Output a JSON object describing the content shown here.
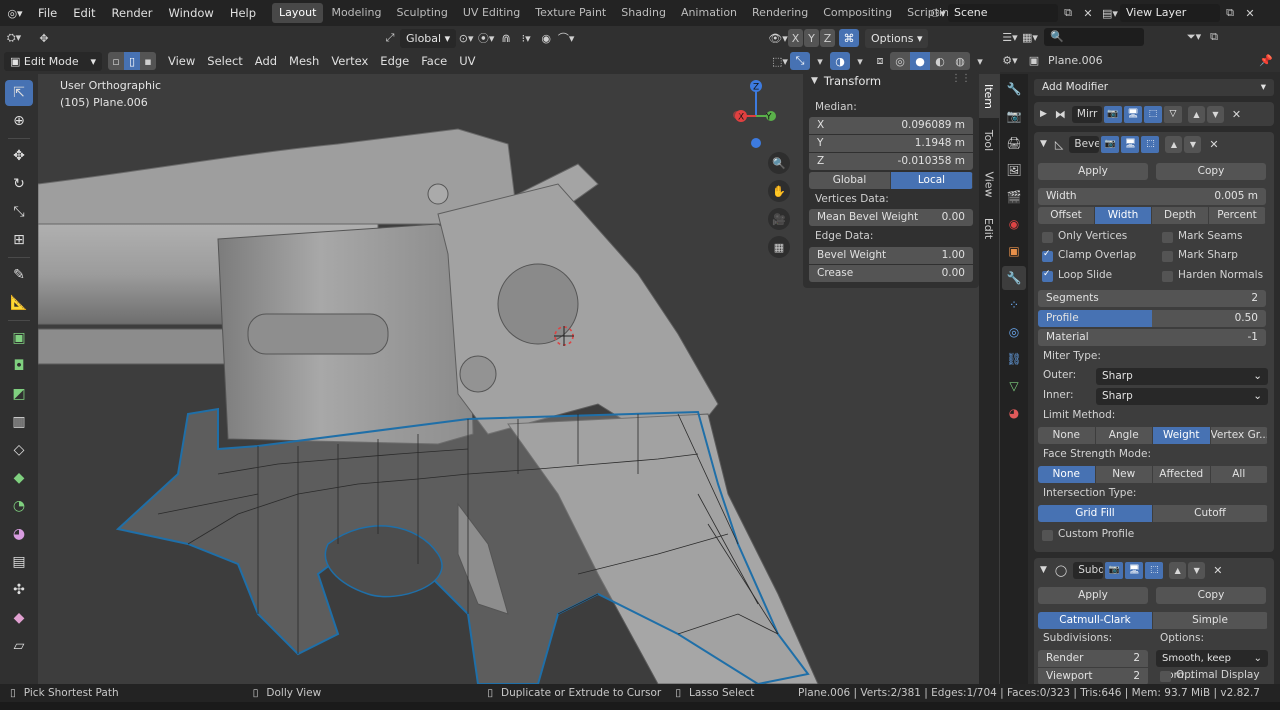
{
  "topmenu": {
    "file": "File",
    "edit": "Edit",
    "render": "Render",
    "window": "Window",
    "help": "Help"
  },
  "workspaces": [
    "Layout",
    "Modeling",
    "Sculpting",
    "UV Editing",
    "Texture Paint",
    "Shading",
    "Animation",
    "Rendering",
    "Compositing",
    "Scripting"
  ],
  "scene": {
    "name": "Scene",
    "view_layer": "View Layer"
  },
  "header": {
    "mode": "Edit Mode",
    "view": "View",
    "select": "Select",
    "add": "Add",
    "mesh": "Mesh",
    "vertex": "Vertex",
    "edge": "Edge",
    "face": "Face",
    "uv": "UV",
    "orientation": "Global",
    "options": "Options"
  },
  "viewport": {
    "view_name": "User Orthographic",
    "object_info": "(105) Plane.006",
    "axes": {
      "x": "X",
      "y": "Y",
      "z": "Z"
    }
  },
  "transform_panel": {
    "title": "Transform",
    "median_label": "Median:",
    "x_label": "X",
    "x": "0.096089 m",
    "y_label": "Y",
    "y": "1.1948 m",
    "z_label": "Z",
    "z": "-0.010358 m",
    "global": "Global",
    "local": "Local",
    "vertices_data": "Vertices Data:",
    "mean_bevel_label": "Mean Bevel Weight",
    "mean_bevel": "0.00",
    "edge_data": "Edge Data:",
    "bevel_weight_label": "Bevel Weight",
    "bevel_weight": "1.00",
    "crease_label": "Crease",
    "crease": "0.00"
  },
  "side_tabs": [
    "Item",
    "Tool",
    "View",
    "Edit"
  ],
  "properties": {
    "object_name": "Plane.006",
    "add_modifier": "Add Modifier",
    "mirror": {
      "name": "Mirr"
    },
    "bevel": {
      "name": "Beve",
      "apply": "Apply",
      "copy": "Copy",
      "width_label": "Width",
      "width": "0.005 m",
      "width_types": [
        "Offset",
        "Width",
        "Depth",
        "Percent"
      ],
      "only_vertices": "Only Vertices",
      "mark_seams": "Mark Seams",
      "clamp_overlap": "Clamp Overlap",
      "mark_sharp": "Mark Sharp",
      "loop_slide": "Loop Slide",
      "harden_normals": "Harden Normals",
      "segments_label": "Segments",
      "segments": "2",
      "profile_label": "Profile",
      "profile": "0.50",
      "profile_fraction": 0.5,
      "material_label": "Material",
      "material": "-1",
      "miter_type": "Miter Type:",
      "outer_label": "Outer:",
      "outer": "Sharp",
      "inner_label": "Inner:",
      "inner": "Sharp",
      "limit_method": "Limit Method:",
      "limit_options": [
        "None",
        "Angle",
        "Weight",
        "Vertex Gr..."
      ],
      "face_strength": "Face Strength Mode:",
      "face_strength_options": [
        "None",
        "New",
        "Affected",
        "All"
      ],
      "intersection": "Intersection Type:",
      "intersection_options": [
        "Grid Fill",
        "Cutoff"
      ],
      "custom_profile": "Custom Profile"
    },
    "subsurf": {
      "name": "Subd",
      "apply": "Apply",
      "copy": "Copy",
      "types": [
        "Catmull-Clark",
        "Simple"
      ],
      "subdivisions_label": "Subdivisions:",
      "options_label": "Options:",
      "render_label": "Render",
      "render": "2",
      "viewport_label": "Viewport",
      "viewport": "2",
      "uv_smooth": "Smooth, keep corn...",
      "optimal_display": "Optimal Display"
    }
  },
  "status": {
    "pick": "Pick Shortest Path",
    "dolly": "Dolly View",
    "extrude": "Duplicate or Extrude to Cursor",
    "lasso": "Lasso Select",
    "stats": "Plane.006 | Verts:2/381 | Edges:1/704 | Faces:0/323 | Tris:646 | Mem: 93.7 MiB | v2.82.7"
  },
  "colors": {
    "accent": "#4772b3",
    "mesh_wire": "#1f6fa8",
    "gun": "#9a9a9a"
  }
}
